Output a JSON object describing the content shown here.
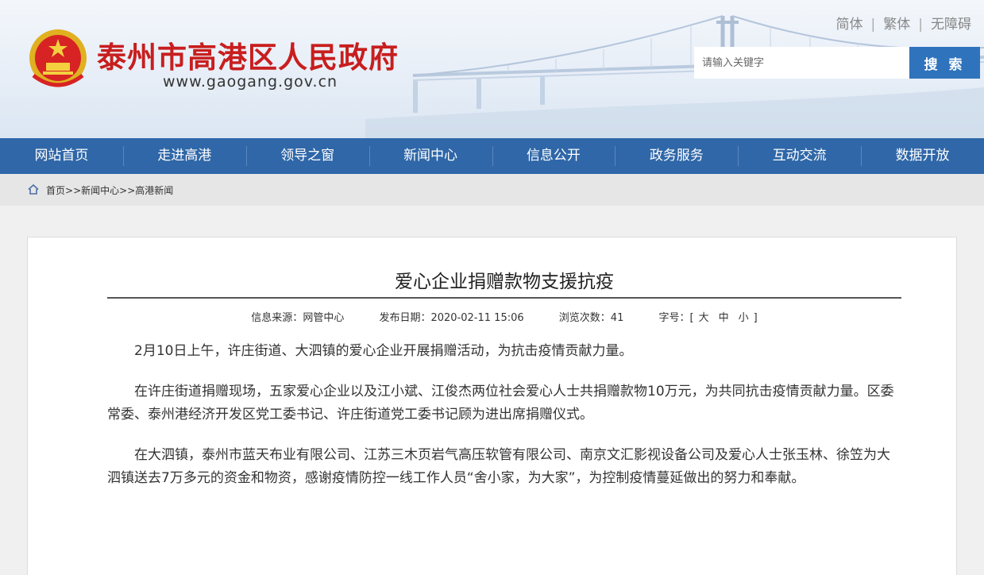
{
  "header": {
    "site_title": "泰州市高港区人民政府",
    "site_url": "www.gaogang.gov.cn",
    "lang_links": [
      "简体",
      "繁体",
      "无障碍"
    ],
    "search_placeholder": "请输入关键字",
    "search_button": "搜 索"
  },
  "nav": {
    "items": [
      "网站首页",
      "走进高港",
      "领导之窗",
      "新闻中心",
      "信息公开",
      "政务服务",
      "互动交流",
      "数据开放"
    ]
  },
  "breadcrumb": {
    "items": [
      "首页",
      "新闻中心",
      "高港新闻"
    ],
    "separator": ">>"
  },
  "article": {
    "title": "爱心企业捐赠款物支援抗疫",
    "source_label": "信息来源：",
    "source": "网管中心",
    "date_label": "发布日期：",
    "date": "2020-02-11 15:06",
    "views_label": "浏览次数：",
    "views": "41",
    "font_size_label": "字号：",
    "font_size_open": "[",
    "font_size_close": "]",
    "font_sizes": [
      "大",
      "中",
      "小"
    ],
    "paragraphs": [
      "2月10日上午，许庄街道、大泗镇的爱心企业开展捐赠活动，为抗击疫情贡献力量。",
      "在许庄街道捐赠现场，五家爱心企业以及江小斌、江俊杰两位社会爱心人士共捐赠款物10万元，为共同抗击疫情贡献力量。区委常委、泰州港经济开发区党工委书记、许庄街道党工委书记顾为进出席捐赠仪式。",
      "在大泗镇，泰州市蓝天布业有限公司、江苏三木页岩气高压软管有限公司、南京文汇影视设备公司及爱心人士张玉林、徐笠为大泗镇送去7万多元的资金和物资，感谢疫情防控一线工作人员“舍小家，为大家”，为控制疫情蔓延做出的努力和奉献。"
    ]
  },
  "colors": {
    "title_red": "#c81e1e",
    "nav_blue": "#2f67a8",
    "search_blue": "#2f73bd"
  },
  "icons": {
    "emblem": "national-emblem-icon",
    "home": "home-icon"
  }
}
